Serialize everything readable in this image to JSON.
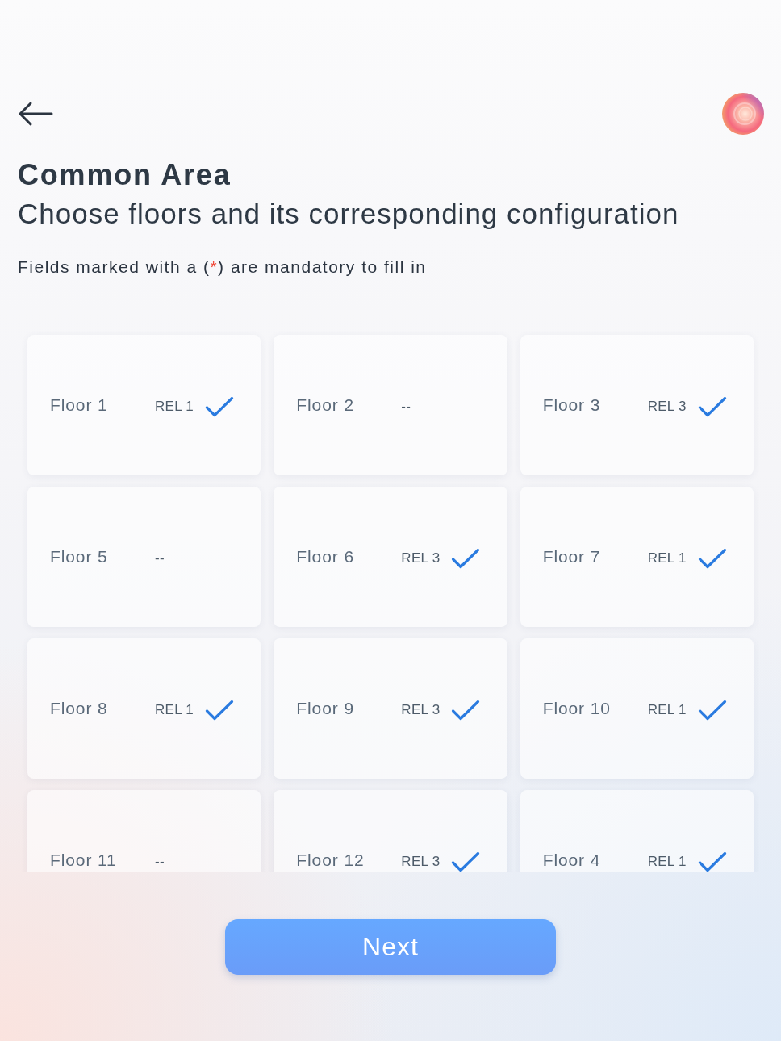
{
  "header": {
    "title": "Common Area",
    "subtitle": "Choose floors and its corresponding configuration"
  },
  "note": {
    "before": "Fields marked with a (",
    "required_mark": "*",
    "after": ") are mandatory to fill in"
  },
  "floors": [
    {
      "label": "Floor 1",
      "config": "REL 1",
      "checked": true
    },
    {
      "label": "Floor 2",
      "config": "--",
      "checked": false
    },
    {
      "label": "Floor 3",
      "config": "REL 3",
      "checked": true
    },
    {
      "label": "Floor 5",
      "config": "--",
      "checked": false
    },
    {
      "label": "Floor 6",
      "config": "REL 3",
      "checked": true
    },
    {
      "label": "Floor 7",
      "config": "REL 1",
      "checked": true
    },
    {
      "label": "Floor 8",
      "config": "REL 1",
      "checked": true
    },
    {
      "label": "Floor 9",
      "config": "REL 3",
      "checked": true
    },
    {
      "label": "Floor 10",
      "config": "REL 1",
      "checked": true
    },
    {
      "label": "Floor 11",
      "config": "--",
      "checked": false
    },
    {
      "label": "Floor 12",
      "config": "REL 3",
      "checked": true
    },
    {
      "label": "Floor 4",
      "config": "REL 1",
      "checked": true
    }
  ],
  "next_button": {
    "label": "Next"
  }
}
